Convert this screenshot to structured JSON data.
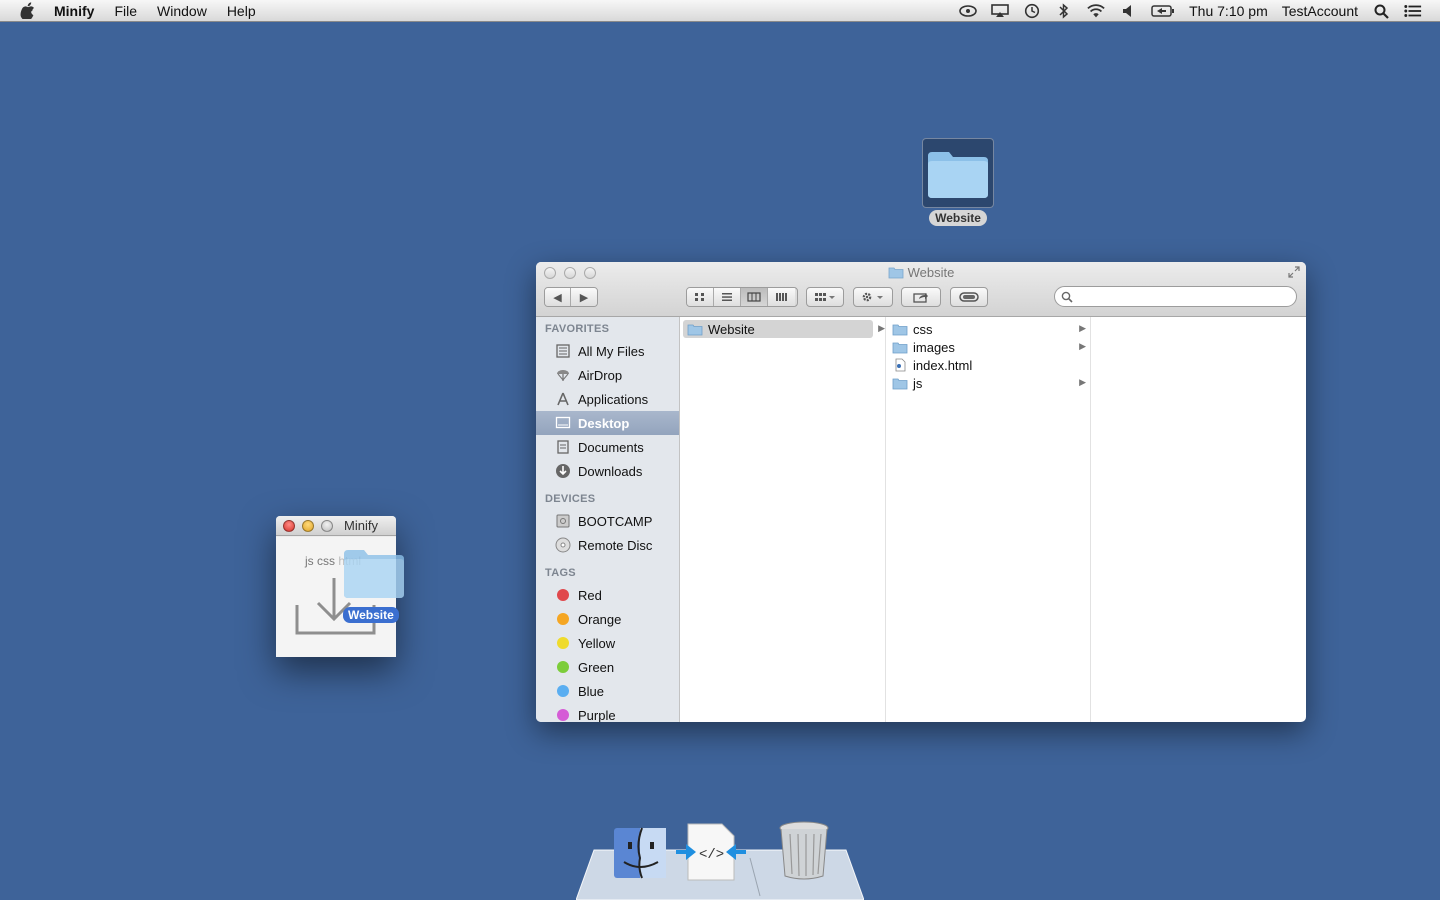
{
  "menubar": {
    "app_name": "Minify",
    "menus": [
      "File",
      "Window",
      "Help"
    ],
    "clock": "Thu 7:10 pm",
    "account": "TestAccount"
  },
  "desktop": {
    "icon_label": "Website"
  },
  "finder": {
    "title": "Website",
    "search_placeholder": "",
    "sidebar": {
      "favorites_header": "FAVORITES",
      "favorites": [
        "All My Files",
        "AirDrop",
        "Applications",
        "Desktop",
        "Documents",
        "Downloads"
      ],
      "devices_header": "DEVICES",
      "devices": [
        "BOOTCAMP",
        "Remote Disc"
      ],
      "tags_header": "TAGS",
      "tags": [
        {
          "label": "Red",
          "color": "#e0484c"
        },
        {
          "label": "Orange",
          "color": "#f5a623"
        },
        {
          "label": "Yellow",
          "color": "#efdb2c"
        },
        {
          "label": "Green",
          "color": "#7ccd3a"
        },
        {
          "label": "Blue",
          "color": "#5aaef1"
        },
        {
          "label": "Purple",
          "color": "#d55cd6"
        }
      ]
    },
    "column1": [
      "Website"
    ],
    "column2": [
      {
        "name": "css",
        "kind": "folder"
      },
      {
        "name": "images",
        "kind": "folder"
      },
      {
        "name": "index.html",
        "kind": "file"
      },
      {
        "name": "js",
        "kind": "folder"
      }
    ]
  },
  "minify": {
    "title": "Minify",
    "types_js": "js",
    "types_css": "css",
    "types_html": "html",
    "drag_label": "Website"
  }
}
